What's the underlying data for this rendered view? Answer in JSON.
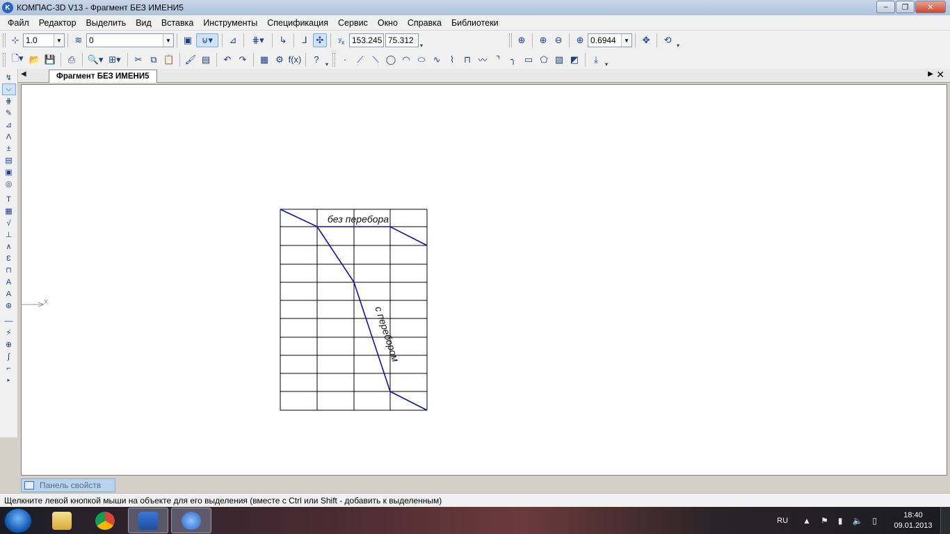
{
  "window": {
    "title": "КОМПАС-3D V13 - Фрагмент БЕЗ ИМЕНИ5",
    "app_icon_letter": "K",
    "controls": {
      "minimize": "–",
      "maximize": "❐",
      "close": "✕"
    }
  },
  "menu": [
    "Файл",
    "Редактор",
    "Выделить",
    "Вид",
    "Вставка",
    "Инструменты",
    "Спецификация",
    "Сервис",
    "Окно",
    "Справка",
    "Библиотеки"
  ],
  "toolbar_current": {
    "step_value": "1.0",
    "layer_value": "0",
    "coord_x": "153.245",
    "coord_y": "75.312",
    "zoom_value": "0.6944"
  },
  "document_tab": {
    "label": "Фрагмент БЕЗ ИМЕНИ5"
  },
  "drawing": {
    "line_color": "#1010b0",
    "grid_color": "#000000",
    "label_top": "без перебора",
    "label_diagonal": "с перебором",
    "axis_label": "X"
  },
  "properties_panel": {
    "label": "Панель свойств"
  },
  "status": {
    "text": "Щелкните левой кнопкой мыши на объекте для его выделения (вместе с Ctrl или Shift - добавить к выделенным)"
  },
  "taskbar": {
    "language": "RU",
    "time": "18:40",
    "date": "09.01.2013"
  }
}
